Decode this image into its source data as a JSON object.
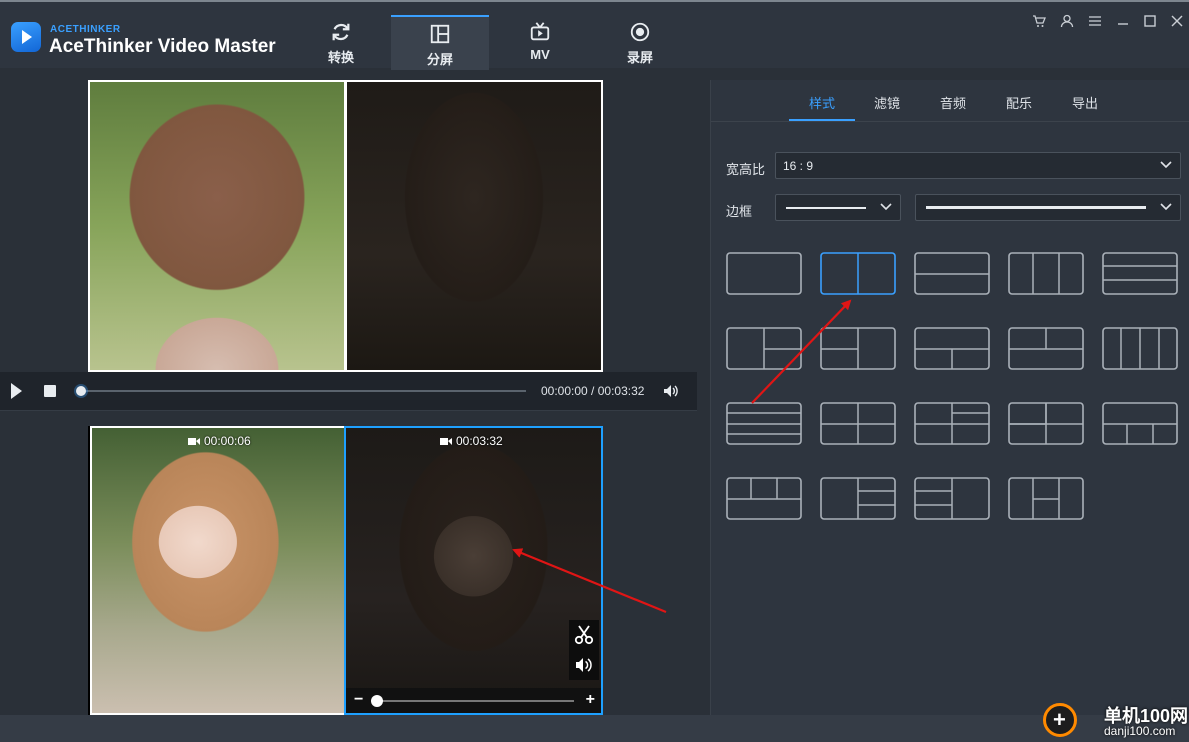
{
  "app": {
    "brand_small": "ACETHINKER",
    "brand_big": "AceThinker Video Master"
  },
  "tabs": [
    {
      "label": "转换",
      "icon": "refresh-icon"
    },
    {
      "label": "分屏",
      "icon": "split-screen-icon",
      "active": true
    },
    {
      "label": "MV",
      "icon": "tv-icon"
    },
    {
      "label": "录屏",
      "icon": "record-icon"
    }
  ],
  "window_controls": [
    "cart-icon",
    "user-icon",
    "menu-icon",
    "minimize-icon",
    "maximize-icon",
    "close-icon"
  ],
  "preview": {
    "time_current": "00:00:00",
    "time_separator": " / ",
    "time_total": "00:03:32",
    "progress": 0
  },
  "clips": [
    {
      "duration": "00:00:06"
    },
    {
      "duration": "00:03:32",
      "selected": true
    }
  ],
  "clip_tools": [
    "scissors-icon",
    "volume-icon"
  ],
  "zoom": {
    "minus": "−",
    "plus": "+",
    "level": 0
  },
  "panel": {
    "tabs": [
      "样式",
      "滤镜",
      "音频",
      "配乐",
      "导出"
    ],
    "active_tab": "样式",
    "aspect_label": "宽高比",
    "aspect_value": "16 : 9",
    "border_label": "边框"
  },
  "layouts": {
    "count": 19,
    "selected_index": 1
  },
  "colors": {
    "accent": "#3aa0ff",
    "selection": "#1ea0ff",
    "annotation_arrow": "#e01515"
  },
  "watermark": {
    "name": "单机100网",
    "url": "danji100.com"
  }
}
